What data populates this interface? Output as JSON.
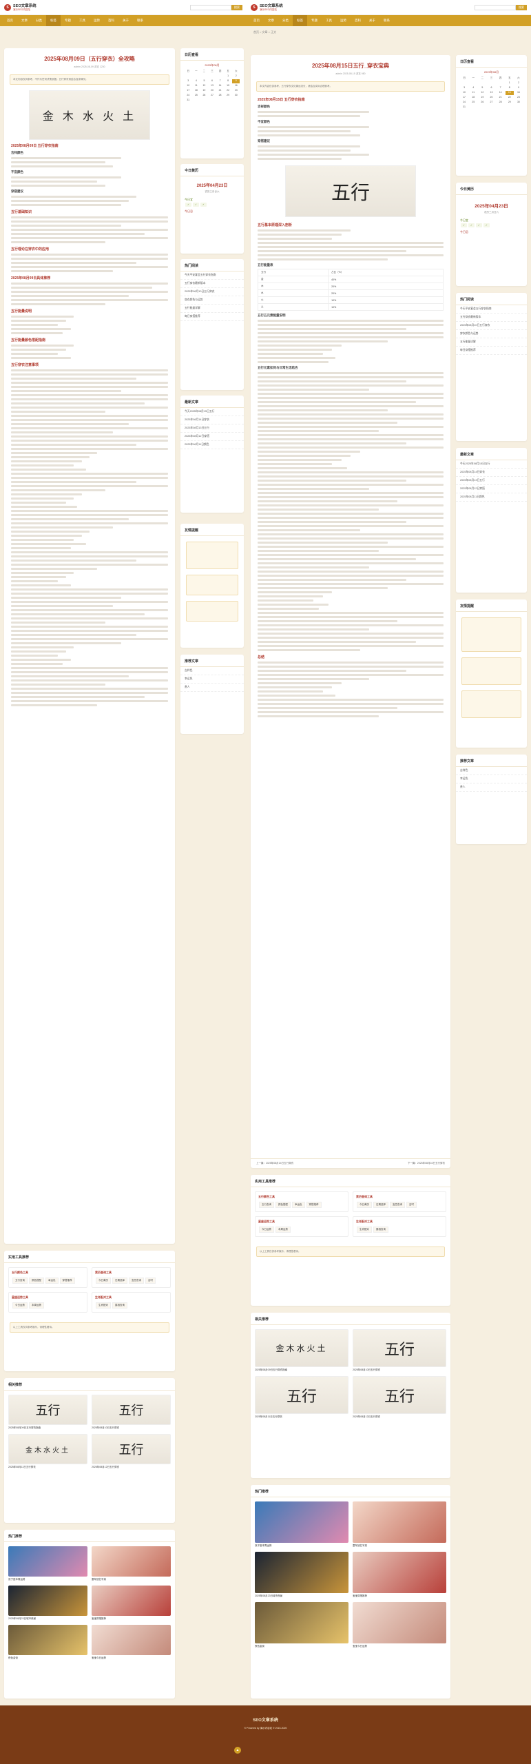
{
  "site": {
    "name": "SEO文章系统",
    "tagline": "演示SEO内容站",
    "search_btn": "搜索",
    "search_placeholder": ""
  },
  "nav": [
    "首页",
    "文章",
    "分类",
    "标签",
    "专题",
    "工具",
    "运势",
    "百科",
    "关于",
    "联系"
  ],
  "left_article": {
    "title": "2025年08月09日（五行穿衣）全攻略",
    "meta": "admin  2025-08-09  浏览 1230",
    "notice": "本文内容仅供参考，不作为任何决策依据。五行穿衣请结合自身情况。",
    "art_text": "金 木 水 火 土",
    "sections": [
      "2025年08月09日 五行穿衣指南",
      "吉祥颜色",
      "不宜颜色",
      "穿搭建议",
      "五行基础知识",
      "五行理论在穿衣中的应用",
      "2025年08月09日具体推荐",
      "五行能量说明",
      "五行能量颜色搭配指南",
      "五行穿衣注意事项"
    ]
  },
  "right_article": {
    "breadcrumb": "首页 > 文章 > 正文",
    "title": "2025年08月15日五行_穿衣宝典",
    "meta": "admin  2025-08-15  浏览 980",
    "notice": "本文内容仅供参考，五行穿衣文化源远流长，请结合实际合理参考。",
    "art_text": "五行",
    "sections": [
      "2025年08月15日 五行穿衣指南",
      "吉祥颜色",
      "不宜颜色",
      "穿搭建议",
      "五行基本原理深入剖析",
      "五行能量表",
      "五行五元素能量说明",
      "五行元素如何与日常生活结合",
      "总结"
    ],
    "table": [
      [
        "五行",
        "占比（%）"
      ],
      [
        "金",
        "40%"
      ],
      [
        "木",
        "20%"
      ],
      [
        "水",
        "20%"
      ],
      [
        "火",
        "10%"
      ],
      [
        "土",
        "10%"
      ]
    ],
    "prev": "上一篇：2025年08月14日五行穿衣",
    "next": "下一篇：2025年08月16日五行穿衣"
  },
  "sidebar": {
    "calendar_title": "日历查看",
    "calendar_month": "2025年08月",
    "weekdays": [
      "日",
      "一",
      "二",
      "三",
      "四",
      "五",
      "六"
    ],
    "today_title": "今日黄历",
    "today_date": "2025年04月23日",
    "today_lunar": "农历三月廿六",
    "yi_label": "今日宜",
    "ji_label": "今日忌",
    "hot_title": "热门阅读",
    "hot": [
      "今天平安宴会五行穿衣指南",
      "五行穿衣最新版本",
      "2025年08月10日五行穿衣",
      "穿衣颜色与运势",
      "五行能量详解",
      "每日穿搭推荐"
    ],
    "latest_title": "最新文章",
    "latest": [
      "今天2025年08月15日五行",
      "2025年08月14日穿衣",
      "2025年08月13日五行",
      "2025年08月12日穿搭",
      "2025年08月11日颜色"
    ],
    "notice_title": "友情提醒",
    "recommend_title": "推荐文章",
    "recommend": [
      "吉祥色",
      "幸运色",
      "贵人"
    ]
  },
  "tools": {
    "title": "实用工具推荐",
    "groups": [
      {
        "name": "五行颜色工具",
        "items": [
          "五行查询",
          "颜色搭配",
          "幸运色",
          "穿搭推荐"
        ]
      },
      {
        "name": "黄历查询工具",
        "items": [
          "今日黄历",
          "日期选择",
          "宜忌查询",
          "吉时"
        ]
      },
      {
        "name": "星座运势工具",
        "items": [
          "今日运势",
          "本周运势"
        ]
      },
      {
        "name": "生肖配对工具",
        "items": [
          "生肖配对",
          "属相查询"
        ]
      }
    ],
    "note": "以上工具仅供参考娱乐，请理性看待。"
  },
  "related": {
    "title": "相关推荐",
    "items": [
      "2025年08月09日五行穿衣指南",
      "2025年08月10日五行穿衣",
      "2025年08月11日五行穿衣",
      "2025年08月12日五行穿衣"
    ]
  },
  "hotrec": {
    "title": "热门推荐",
    "items": [
      "双子座本周运势",
      "童年回忆写真",
      "2025年08月23日城市夜景",
      "宝宝穿搭推荐",
      "夜色金街",
      "宝宝今日运势"
    ]
  },
  "footer": {
    "name": "SEO文章系统",
    "copy": "© Powered by 演示内容站 © 2015-2025"
  }
}
